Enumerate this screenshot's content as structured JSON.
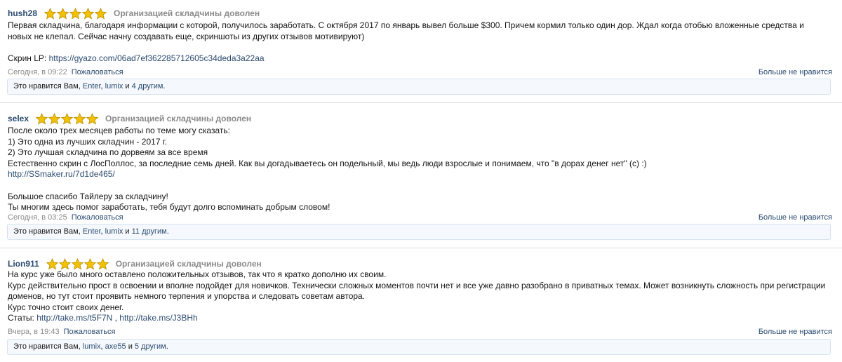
{
  "reviews": [
    {
      "author": "hush28",
      "rating": 5,
      "verdict": "Организацией складчины доволен",
      "lines": [
        {
          "text": "Первая складчина, благодаря информации с которой, получилось заработать. С октября 2017 по январь вывел больше $300. Причем кормил только один дор. Ждал когда отобью вложенные средства и"
        },
        {
          "text": "новых не клепал. Сейчас начну создавать еще, скриншоты из других отзывов мотивируют)"
        },
        {
          "text": ""
        },
        {
          "text": "Скрин LP: ",
          "link": "https://gyazo.com/06ad7ef362285712605c34deda3a22aa"
        }
      ],
      "time": "Сегодня, в 09:22",
      "report": "Пожаловаться",
      "unlike": "Больше не нравится",
      "likes": {
        "prefix": "Это нравится Вам, ",
        "u1": "Enter",
        "sep": ", ",
        "u2": "lumix",
        "and": " и ",
        "others": "4 другим",
        "end": "."
      }
    },
    {
      "author": "selex",
      "rating": 5,
      "verdict": "Организацией складчины доволен",
      "lines": [
        {
          "text": "После около трех месяцев работы по теме могу сказать:"
        },
        {
          "text": "1) Это одна из лучших складчин - 2017 г."
        },
        {
          "text": "2) Это лучшая складчина по дорвеям за все время"
        },
        {
          "text": "Естественно скрин с ЛосПоллос, за последние семь дней. Как вы догадываетесь он подельный, мы ведь люди взрослые и понимаем, что \"в дорах денег нет\" (с) :)"
        },
        {
          "text": "",
          "link": "http://SSmaker.ru/7d1de465/"
        },
        {
          "text": ""
        },
        {
          "text": "Большое спасибо Тайлеру за складчину!"
        },
        {
          "text": "Ты многим здесь помог заработать, тебя будут долго вспоминать добрым словом!"
        }
      ],
      "time": "Сегодня, в 03:25",
      "report": "Пожаловаться",
      "unlike": "Больше не нравится",
      "likes": {
        "prefix": "Это нравится Вам, ",
        "u1": "Enter",
        "sep": ", ",
        "u2": "lumix",
        "and": " и ",
        "others": "11 другим",
        "end": "."
      }
    },
    {
      "author": "Lion911",
      "rating": 5,
      "verdict": "Организацией складчины доволен",
      "lines": [
        {
          "text": "На курс уже было много оставлено положительных отзывов, так что я кратко дополню их своим."
        },
        {
          "text": "Курс действительно прост в освоении и вполне подойдет для новичков. Технически сложных моментов почти нет и все уже давно разобрано в приватных темах. Может возникнуть сложность при регистрации"
        },
        {
          "text": "доменов, но тут стоит проявить немного терпения и упорства и следовать советам автора."
        },
        {
          "text": "Курс точно стоит своих денег."
        },
        {
          "text": "Статы: ",
          "link": "http://take.ms/t5F7N",
          "mid": " , ",
          "link2": "http://take.ms/J3BHh"
        }
      ],
      "time": "Вчера, в 19:43",
      "report": "Пожаловаться",
      "unlike": "Больше не нравится",
      "likes": {
        "prefix": "Это нравится Вам, ",
        "u1": "lumix",
        "sep": ", ",
        "u2": "axe55",
        "and": " и ",
        "others": "5 другим",
        "end": "."
      }
    }
  ],
  "colors": {
    "link": "#2b4b70",
    "muted": "#8a8a8a",
    "star": "#f2c200"
  }
}
